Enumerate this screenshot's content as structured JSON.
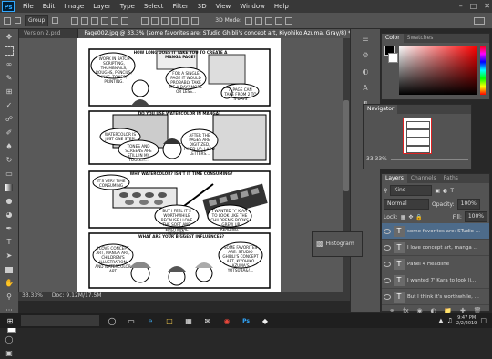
{
  "app": {
    "logo": "Ps"
  },
  "menu": [
    "File",
    "Edit",
    "Image",
    "Layer",
    "Type",
    "Select",
    "Filter",
    "3D",
    "View",
    "Window",
    "Help"
  ],
  "options": {
    "auto_select": "Group",
    "mode_3d": "3D Mode:"
  },
  "tabs": [
    {
      "label": "Version 2.psd"
    },
    {
      "label": "Page002.jpg @ 33.3% (some favorites are: STudio Ghibli's concept art, Kiyohiko Azuma, Gray/8) *"
    }
  ],
  "status": {
    "zoom": "33.33%",
    "doc": "Doc: 9.12M/17.5M"
  },
  "color_panel": {
    "tabs": [
      "Color",
      "Swatches"
    ]
  },
  "navigator": {
    "title": "Navigator",
    "zoom": "33.33%"
  },
  "histogram": {
    "label": "Histogram"
  },
  "layers_panel": {
    "tabs": [
      "Layers",
      "Channels",
      "Paths"
    ],
    "kind": "Kind",
    "blend": "Normal",
    "opacity_label": "Opacity:",
    "opacity": "100%",
    "lock_label": "Lock:",
    "fill_label": "Fill:",
    "fill": "100%",
    "rows": [
      "some favorites are: STudio ...",
      "I love concept art,  manga ...",
      "Panel 4 Headline",
      "I wanted 7' Kara  to look li...",
      "But I think  it's worthwhile, ..."
    ]
  },
  "comic": {
    "q1": "HOW LONG DOES IT TAKE YOU TO CREATE A MANGA PAGE?",
    "p1a": "I WORK IN BATCH- SCRIPTING, THUMBNAILS, ROUGHS, PENCILS, INKS, TONES, PRINTING.",
    "p1b": "FOR A SINGLE PAGE IT WOULD PROBABLY TAKE ME A DAY? MORE OR LESS...",
    "p1c": "A PAGE CAN TAKE FROM 2 TO 4 DAYS",
    "q2": "DO YOU USE WATERCOLOR IN MANGA?",
    "p2a": "WATERCOLOR IS JUST ONE STEP!",
    "p2b": "TONES AND SCREENS ARE STILL IN MY TOOLKIT...",
    "p2c": "AFTER THE PAGES ARE DIGITIZED, FIXED UP, I ADD LETTERS...",
    "q3": "WHY WATERCOLOR? ISN'T IT TIME CONSUMING?",
    "p3a": "IT'S VERY TIME CONSUMING",
    "p3b": "BUT I FEEL IT'S WORTHWHILE BECAUSE I LOVE THE SOFT AND EMOTIONAL RESULTS.",
    "p3c": "I WANTED 'Y' KIAA TO LOOK LIKE THE CHILDREN'S BOOKS I GREW UP READING.",
    "q4": "WHAT ARE YOUR BIGGEST INFLUENCES?",
    "p4a": "I LOVE CONCEPT ART, MANGA ART, CHILDREN'S ILLUSTRATION AND WATERCOLOR ART",
    "p4b": "SOME FAVORITES ARE: STUDIO GHIBLI'S CONCEPT ART, KIYOHIKO AZUMA'S YOTSUBA&!..."
  },
  "clock": {
    "time": "9:47 PM",
    "date": "2/2/2019"
  }
}
